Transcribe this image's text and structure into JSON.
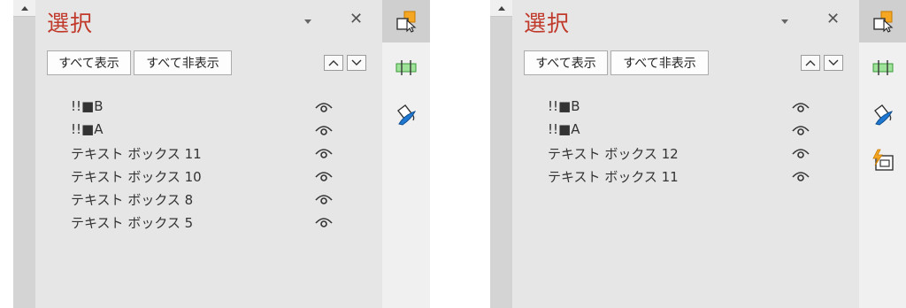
{
  "left_pane": {
    "title": "選択",
    "show_all_label": "すべて表示",
    "hide_all_label": "すべて非表示",
    "items": [
      {
        "label": "!!■B"
      },
      {
        "label": "!!■A"
      },
      {
        "label": "テキスト ボックス 11"
      },
      {
        "label": "テキスト ボックス 10"
      },
      {
        "label": "テキスト ボックス 8"
      },
      {
        "label": "テキスト ボックス 5"
      }
    ],
    "tools": [
      "selection-pane-icon",
      "align-icon",
      "format-paint-icon"
    ]
  },
  "right_pane": {
    "title": "選択",
    "show_all_label": "すべて表示",
    "hide_all_label": "すべて非表示",
    "items": [
      {
        "label": "!!■B"
      },
      {
        "label": "!!■A"
      },
      {
        "label": "テキスト ボックス 12"
      },
      {
        "label": "テキスト ボックス 11"
      }
    ],
    "tools": [
      "selection-pane-icon",
      "align-icon",
      "format-paint-icon",
      "animation-icon"
    ]
  },
  "colors": {
    "title": "#c0392b",
    "pane_bg": "#e6e6e6",
    "toolbar_bg": "#f0f0f0",
    "active_tool_bg": "#cfcfcf"
  }
}
